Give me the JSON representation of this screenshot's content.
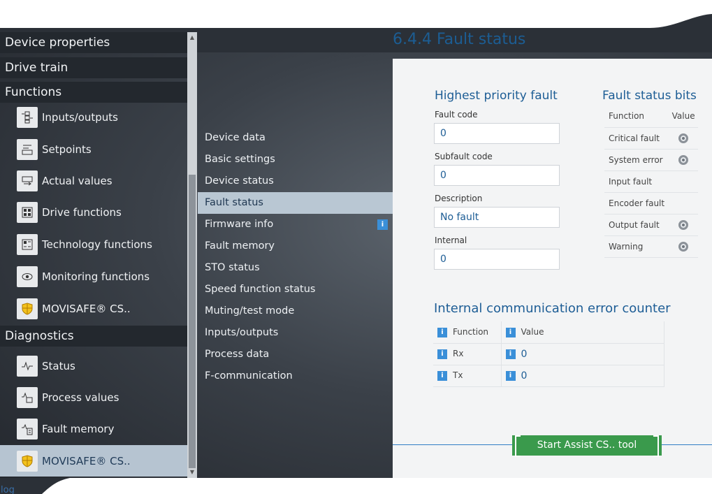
{
  "left_nav": {
    "categories": [
      {
        "label": "Device properties"
      },
      {
        "label": "Drive train"
      },
      {
        "label": "Functions"
      },
      {
        "label": "Diagnostics"
      }
    ],
    "function_items": [
      {
        "label": "Inputs/outputs",
        "icon": "io-icon"
      },
      {
        "label": "Setpoints",
        "icon": "setpoint-icon"
      },
      {
        "label": "Actual values",
        "icon": "actual-values-icon"
      },
      {
        "label": "Drive functions",
        "icon": "drive-functions-icon"
      },
      {
        "label": "Technology functions",
        "icon": "technology-icon"
      },
      {
        "label": "Monitoring functions",
        "icon": "eye-icon"
      },
      {
        "label": "MOVISAFE® CS..",
        "icon": "safety-shield-icon"
      }
    ],
    "diagnostic_items": [
      {
        "label": "Status",
        "icon": "pulse-icon"
      },
      {
        "label": "Process values",
        "icon": "process-values-icon"
      },
      {
        "label": "Fault memory",
        "icon": "fault-memory-icon"
      },
      {
        "label": "MOVISAFE® CS..",
        "icon": "safety-shield-icon",
        "selected": true
      }
    ]
  },
  "mid_list": {
    "items": [
      {
        "label": "Device data"
      },
      {
        "label": "Basic settings"
      },
      {
        "label": "Device status"
      },
      {
        "label": "Fault status",
        "active": true
      },
      {
        "label": "Firmware info",
        "info": "i"
      },
      {
        "label": "Fault memory"
      },
      {
        "label": "STO status"
      },
      {
        "label": "Speed function status"
      },
      {
        "label": "Muting/test mode"
      },
      {
        "label": "Inputs/outputs"
      },
      {
        "label": "Process data"
      },
      {
        "label": "F-communication"
      }
    ]
  },
  "main": {
    "title": "6.4.4 Fault status",
    "highest_priority": {
      "heading": "Highest priority fault",
      "fault_code_label": "Fault code",
      "fault_code": "0",
      "subfault_code_label": "Subfault code",
      "subfault_code": "0",
      "description_label": "Description",
      "description": "No fault",
      "internal_label": "Internal",
      "internal": "0"
    },
    "fault_bits": {
      "heading": "Fault status bits",
      "col_function": "Function",
      "col_value": "Value",
      "rows": [
        {
          "label": "Critical fault",
          "led": true
        },
        {
          "label": "System error",
          "led": true
        },
        {
          "label": "Input fault",
          "led": false
        },
        {
          "label": "Encoder fault",
          "led": false
        },
        {
          "label": "Output fault",
          "led": true
        },
        {
          "label": "Warning",
          "led": true
        }
      ]
    },
    "comm_counter": {
      "heading": "Internal communication error counter",
      "col_function": "Function",
      "col_value": "Value",
      "info": "i",
      "rows": [
        {
          "label": "Rx",
          "value": "0"
        },
        {
          "label": "Tx",
          "value": "0"
        }
      ]
    },
    "assist_button": "Start Assist CS.. tool"
  },
  "footer": {
    "log_label": "log"
  },
  "colors": {
    "accent_blue": "#1d5d95",
    "button_green": "#3a9a4c",
    "selection": "#b9c7d3"
  }
}
